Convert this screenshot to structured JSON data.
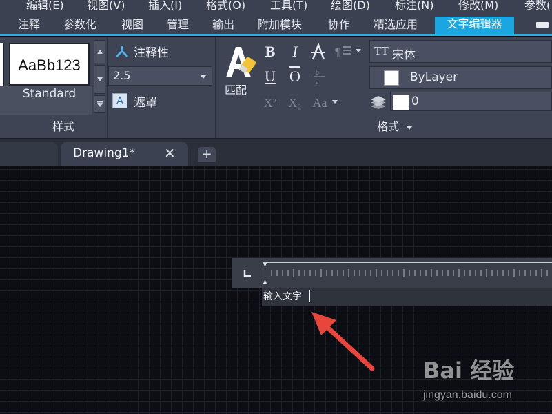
{
  "menu": {
    "items": [
      "编辑(E)",
      "视图(V)",
      "插入(I)",
      "格式(O)",
      "工具(T)",
      "绘图(D)",
      "标注(N)",
      "修改(M)",
      "参数("
    ]
  },
  "ribbon_tabs": {
    "items": [
      "注释",
      "参数化",
      "视图",
      "管理",
      "输出",
      "附加模块",
      "协作",
      "精选应用",
      "文字编辑器"
    ],
    "active": "文字编辑器"
  },
  "style_panel": {
    "preview_text": "AaBb123",
    "style_name": "Standard",
    "annotative_label": "注释性",
    "text_height": "2.5",
    "mask_label": "遮罩",
    "mask_glyph": "A",
    "footer_label": "样式"
  },
  "format_panel": {
    "match_label": "匹配",
    "font_icon": "TT",
    "font_name": "宋体",
    "color_value": "ByLayer",
    "layer_value": "0",
    "footer_label": "格式",
    "buttons": {
      "bold": "B",
      "italic": "I",
      "underline": "U",
      "overline": "O",
      "superscript": "X²",
      "subscript": "X₂",
      "case": "Aa"
    }
  },
  "document_tabs": {
    "active_tab": "Drawing1*",
    "close_glyph": "✕",
    "new_tab_glyph": "+"
  },
  "editor": {
    "input_text": "输入文字"
  },
  "watermark": {
    "logo_text": "Bai 经验",
    "url": "jingyan.baidu.com"
  },
  "colors": {
    "accent": "#1aa6e0",
    "ribbon_bg": "#3e4453",
    "canvas_bg": "#0c0e13",
    "arrow": "#e8453c"
  }
}
